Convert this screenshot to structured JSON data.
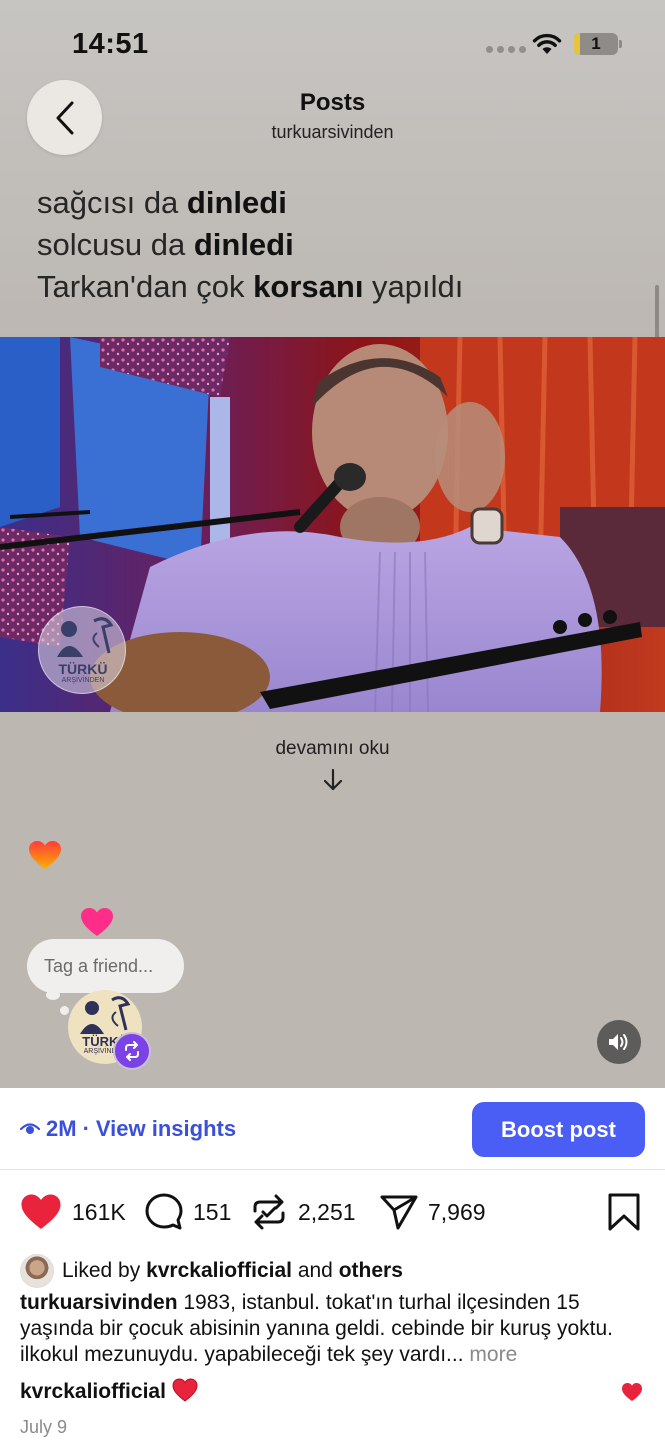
{
  "status_bar": {
    "time": "14:51",
    "battery_level": "1"
  },
  "header": {
    "title": "Posts",
    "subtitle": "turkuarsivinden"
  },
  "post_text": {
    "line1_normal": "sağcısı da ",
    "line1_bold": "dinledi",
    "line2_normal": "solcusu da ",
    "line2_bold": "dinledi",
    "line3_start": "Tarkan'dan çok ",
    "line3_bold": "korsanı",
    "line3_end": " yapıldı"
  },
  "video": {
    "watermark_title": "TÜRKÜ",
    "watermark_subtitle": "ARŞİVİNDEN"
  },
  "read_more": {
    "label": "devamını oku"
  },
  "tag_bubble": {
    "placeholder": "Tag a friend..."
  },
  "account_logo": {
    "title": "TÜRKÜ",
    "subtitle": "ARŞİVİNDEN"
  },
  "insights": {
    "views": "2M",
    "separator": " · ",
    "label": "View insights",
    "boost_label": "Boost post"
  },
  "actions": {
    "likes": "161K",
    "comments": "151",
    "reposts": "2,251",
    "shares": "7,969"
  },
  "liked_by": {
    "prefix": "Liked by ",
    "user": "kvrckaliofficial",
    "middle": " and ",
    "suffix": "others"
  },
  "caption": {
    "username": "turkuarsivinden",
    "text": " 1983, istanbul. tokat'ın turhal ilçesinden 15 yaşında bir çocuk abisinin yanına geldi. cebinde bir kuruş yoktu. ilkokul mezunuydu. yapabileceği tek şey vardı...",
    "more_label": " more"
  },
  "comment": {
    "username": "kvrckaliofficial"
  },
  "date": "July 9",
  "colors": {
    "accent_blue": "#4a5df5",
    "link_blue": "#3b50d9",
    "like_red": "#e8233b",
    "repost_purple": "#7b43e6"
  }
}
